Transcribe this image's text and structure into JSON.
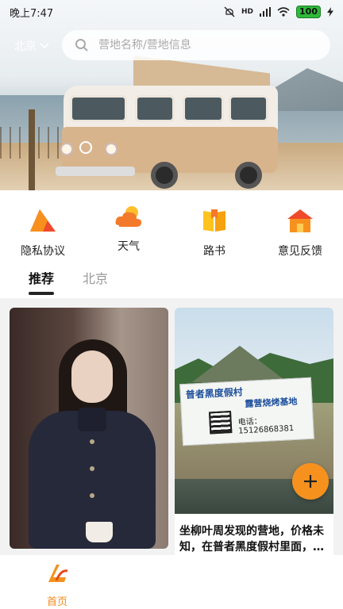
{
  "status_bar": {
    "time": "晚上7:47",
    "network": "HD",
    "battery": "100"
  },
  "header": {
    "city": "北京",
    "search_placeholder": "营地名称/营地信息"
  },
  "quick_nav": [
    {
      "label": "隐私协议",
      "icon": "privacy-icon"
    },
    {
      "label": "天气",
      "icon": "weather-icon"
    },
    {
      "label": "路书",
      "icon": "roadbook-icon"
    },
    {
      "label": "意见反馈",
      "icon": "feedback-icon"
    }
  ],
  "tabs": [
    {
      "label": "推荐",
      "active": true
    },
    {
      "label": "北京",
      "active": false
    }
  ],
  "feed": {
    "cards": [
      {
        "caption": ""
      },
      {
        "caption": "坐柳叶周发现的营地，价格未知，在普者黑度假村里面，…",
        "banner_title": "普者黑度假村",
        "banner_subtitle": "露营烧烤基地",
        "banner_phone": "电话：15126868381"
      }
    ]
  },
  "bottom_nav": [
    {
      "label": "首页",
      "active": true,
      "icon": "home-logo-icon"
    }
  ],
  "colors": {
    "accent": "#f08a1e",
    "fab": "#f7911e"
  }
}
